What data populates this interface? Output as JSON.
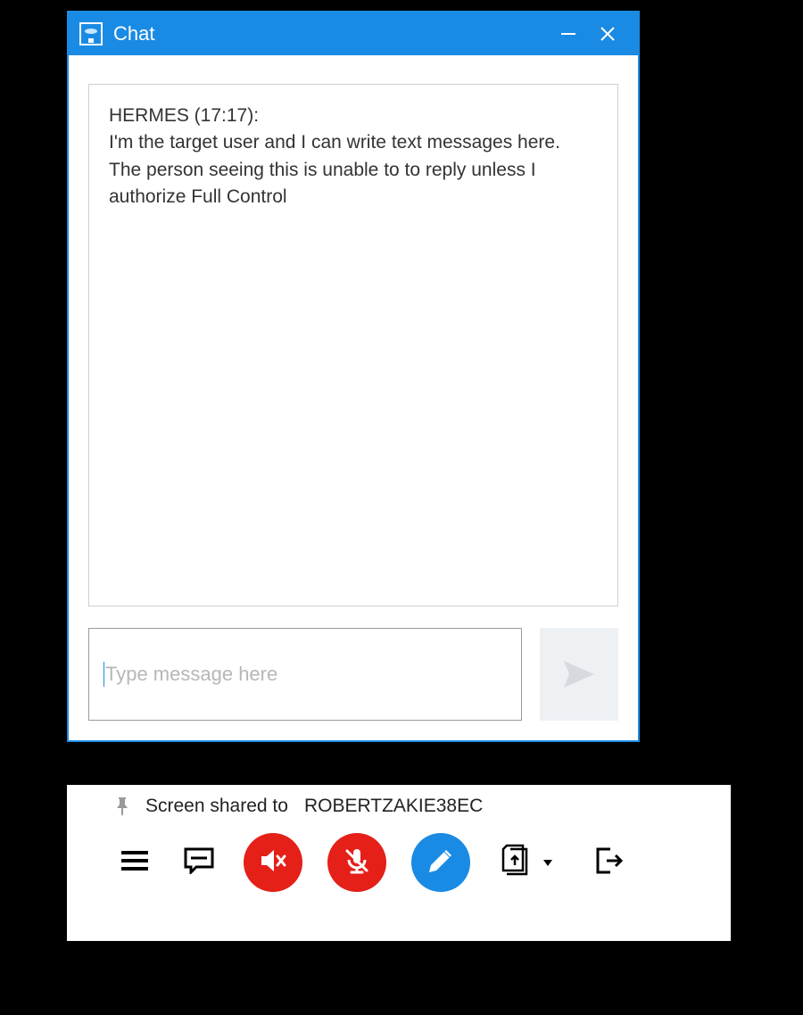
{
  "window": {
    "title": "Chat"
  },
  "chat": {
    "message_header": "HERMES (17:17):",
    "message_body": "I'm the target user and I can write text messages here. The person seeing this is unable to to reply unless I authorize Full Control",
    "input_placeholder": "Type message here"
  },
  "toolbar": {
    "share_label": "Screen shared to",
    "share_target": "ROBERTZAKIE38EC"
  },
  "icons": {
    "minimize": "minimize-icon",
    "close": "close-icon",
    "send": "send-icon",
    "pin": "pin-icon",
    "menu": "menu-icon",
    "chat": "chat-bubble-icon",
    "mute": "speaker-muted-icon",
    "mic_off": "mic-muted-icon",
    "pencil": "pencil-icon",
    "upload": "file-upload-icon",
    "exit": "exit-icon"
  },
  "colors": {
    "accent": "#1a8be4",
    "danger": "#e42019"
  }
}
